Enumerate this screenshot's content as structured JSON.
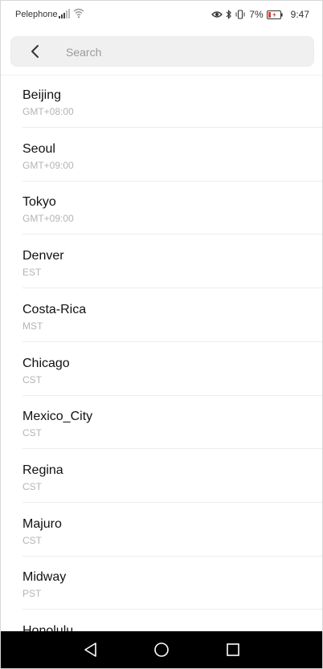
{
  "status_bar": {
    "carrier": "Pelephone",
    "battery_percent": "7%",
    "time": "9:47",
    "icons": [
      "signal-icon",
      "wifi-icon",
      "eye-comfort-icon",
      "bluetooth-icon",
      "vibrate-icon",
      "battery-icon"
    ]
  },
  "search": {
    "placeholder": "Search",
    "value": ""
  },
  "timezones": [
    {
      "city": "Beijing",
      "zone": "GMT+08:00"
    },
    {
      "city": "Seoul",
      "zone": "GMT+09:00"
    },
    {
      "city": "Tokyo",
      "zone": "GMT+09:00"
    },
    {
      "city": "Denver",
      "zone": "EST"
    },
    {
      "city": "Costa-Rica",
      "zone": "MST"
    },
    {
      "city": "Chicago",
      "zone": "CST"
    },
    {
      "city": "Mexico_City",
      "zone": "CST"
    },
    {
      "city": "Regina",
      "zone": "CST"
    },
    {
      "city": "Majuro",
      "zone": "CST"
    },
    {
      "city": "Midway",
      "zone": "PST"
    },
    {
      "city": "Honolulu",
      "zone": ""
    }
  ],
  "nav_bar": {
    "icons": [
      "nav-back-icon",
      "nav-home-icon",
      "nav-recents-icon"
    ]
  }
}
